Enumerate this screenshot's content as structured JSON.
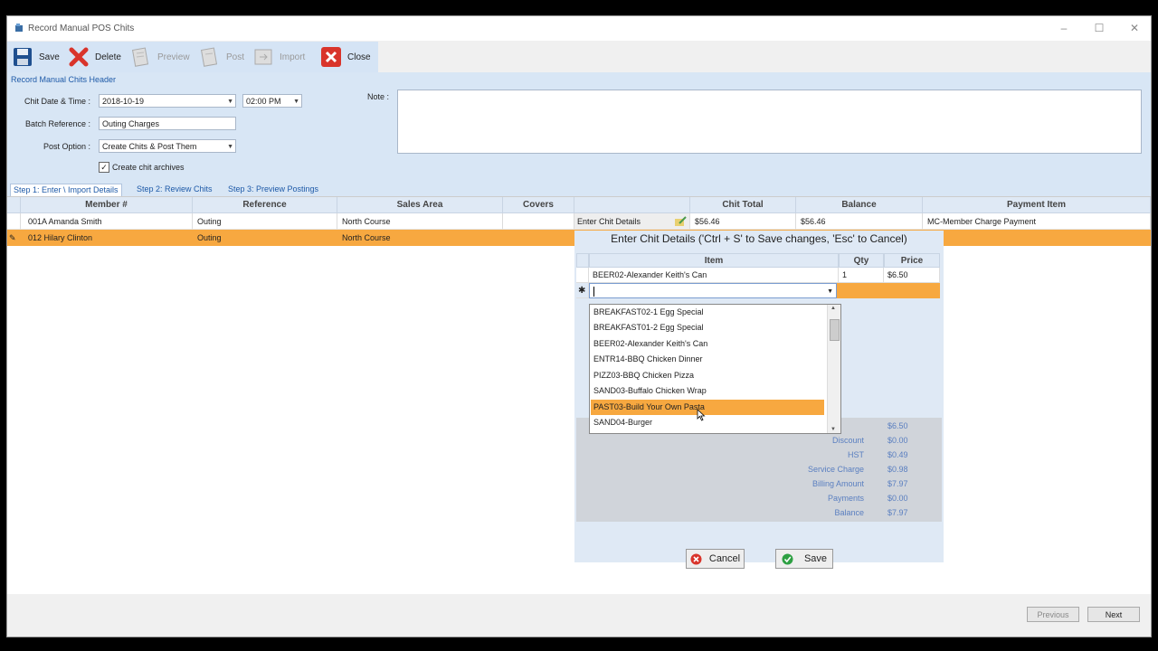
{
  "window": {
    "title": "Record Manual POS Chits"
  },
  "toolbar": {
    "save": "Save",
    "delete": "Delete",
    "preview": "Preview",
    "post": "Post",
    "import": "Import",
    "close": "Close"
  },
  "header": {
    "section_label": "Record Manual Chits Header",
    "chit_date_label": "Chit Date & Time :",
    "chit_date": "2018-10-19",
    "chit_time": "02:00 PM",
    "batch_label": "Batch Reference :",
    "batch_value": "Outing Charges",
    "post_option_label": "Post Option :",
    "post_option_value": "Create Chits & Post Them",
    "archive_label": "Create chit archives",
    "archive_checked": "✓",
    "note_label": "Note :"
  },
  "tabs": [
    "Step 1: Enter \\ Import Details",
    "Step 2: Review Chits",
    "Step 3: Preview Postings"
  ],
  "grid": {
    "headers": [
      "Member #",
      "Reference",
      "Sales Area",
      "Covers",
      "",
      "Chit Total",
      "Balance",
      "Payment Item"
    ],
    "rows": [
      {
        "member": "001A Amanda Smith",
        "reference": "Outing",
        "area": "North Course",
        "covers": "",
        "action": "Enter Chit Details",
        "total": "$56.46",
        "balance": "$56.46",
        "payment": "MC-Member Charge Payment"
      },
      {
        "member": "012 Hilary Clinton",
        "reference": "Outing",
        "area": "North Course",
        "covers": "",
        "action": "",
        "total": "",
        "balance": "",
        "payment": ""
      }
    ]
  },
  "popup": {
    "title": "Enter Chit Details ('Ctrl + S' to Save changes, 'Esc' to Cancel)",
    "headers": {
      "item": "Item",
      "qty": "Qty",
      "price": "Price"
    },
    "line": {
      "item": "BEER02-Alexander Keith's Can",
      "qty": "1",
      "price": "$6.50"
    },
    "new_row_marker": "✱",
    "summary": [
      {
        "label": "",
        "value": "$6.50"
      },
      {
        "label": "Discount",
        "value": "$0.00"
      },
      {
        "label": "HST",
        "value": "$0.49"
      },
      {
        "label": "Service Charge",
        "value": "$0.98"
      },
      {
        "label": "Billing Amount",
        "value": "$7.97"
      },
      {
        "label": "Payments",
        "value": "$0.00"
      },
      {
        "label": "Balance",
        "value": "$7.97"
      }
    ],
    "cancel": "Cancel",
    "save": "Save"
  },
  "dropdown": {
    "items": [
      "BREAKFAST02-1 Egg Special",
      "BREAKFAST01-2 Egg Special",
      "BEER02-Alexander Keith's Can",
      "ENTR14-BBQ Chicken Dinner",
      "PIZZ03-BBQ Chicken Pizza",
      "SAND03-Buffalo Chicken Wrap",
      "PAST03-Build Your Own Pasta",
      "SAND04-Burger"
    ],
    "selected_index": 6
  },
  "nav": {
    "previous": "Previous",
    "next": "Next"
  },
  "colors": {
    "accent": "#f7a840",
    "header_bg": "#d8e6f5",
    "link": "#1e5aa8"
  }
}
